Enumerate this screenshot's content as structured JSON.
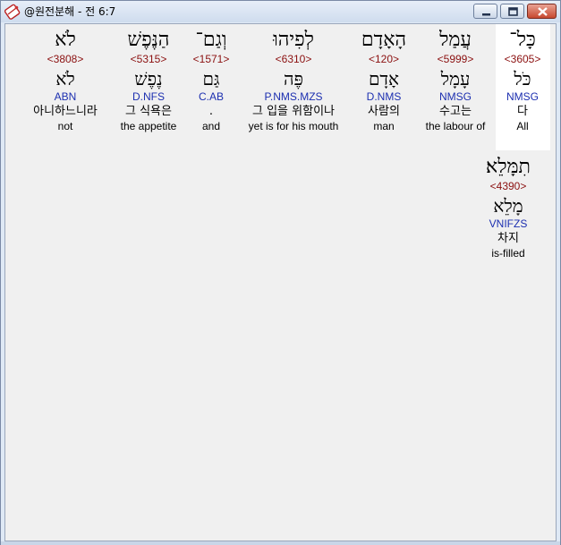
{
  "window": {
    "title": "@원전분해 - 전 6:7"
  },
  "words": [
    {
      "hebrew": "כָּל־",
      "strong": "<3605>",
      "lemma": "כֹּל",
      "morph": "NMSG",
      "korean": "다",
      "english": "All"
    },
    {
      "hebrew": "עֲמַל",
      "strong": "<5999>",
      "lemma": "עָמָל",
      "morph": "NMSG",
      "korean": "수고는",
      "english": "the labour of"
    },
    {
      "hebrew": "הָאָדָם",
      "strong": "<120>",
      "lemma": "אָדָם",
      "morph": "D.NMS",
      "korean": "사람의",
      "english": "man"
    },
    {
      "hebrew": "לְפִיהוּ",
      "strong": "<6310>",
      "lemma": "פֶּה",
      "morph": "P.NMS.MZS",
      "korean": "그 입을 위함이나",
      "english": "yet is for his mouth"
    },
    {
      "hebrew": "וְגַם־",
      "strong": "<1571>",
      "lemma": "גַּם",
      "morph": "C.AB",
      "korean": ".",
      "english": "and"
    },
    {
      "hebrew": "הַנֶּפֶשׁ",
      "strong": "<5315>",
      "lemma": "נֶפֶשׁ",
      "morph": "D.NFS",
      "korean": "그 식욕은",
      "english": "the appetite"
    },
    {
      "hebrew": "לֹא",
      "strong": "<3808>",
      "lemma": "לֹא",
      "morph": "ABN",
      "korean": "아니하느니라",
      "english": "not"
    },
    {
      "hebrew": "תִמָּלֵא׃",
      "strong": "<4390>",
      "lemma": "מָלֵא",
      "morph": "VNIFZS",
      "korean": "차지",
      "english": "is-filled"
    }
  ]
}
